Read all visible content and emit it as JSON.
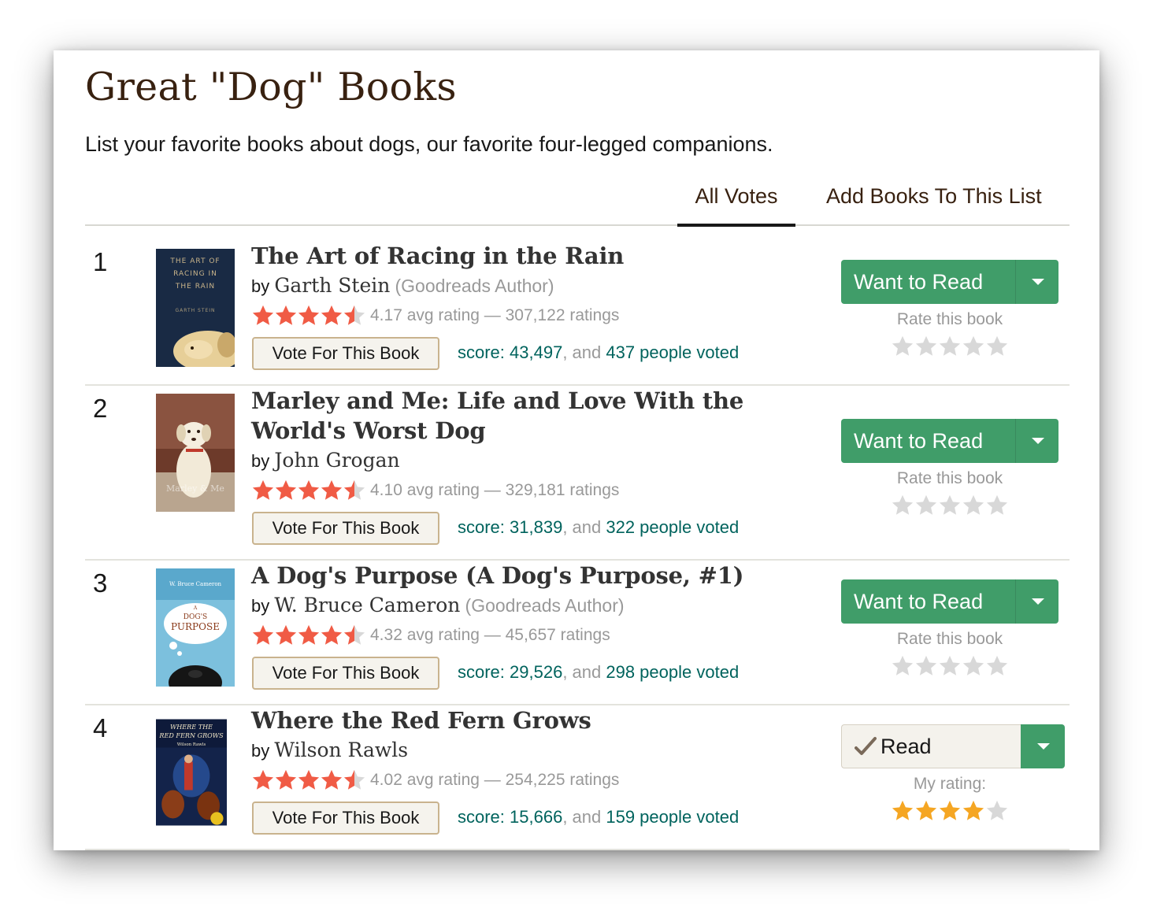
{
  "page": {
    "title": "Great \"Dog\" Books",
    "description": "List your favorite books about dogs, our favorite four-legged companions."
  },
  "tabs": [
    {
      "label": "All Votes",
      "active": true
    },
    {
      "label": "Add Books To This List",
      "active": false
    }
  ],
  "colors": {
    "title_brown": "#382110",
    "shelf_green": "#409d69",
    "link_teal": "#00635d",
    "star_red": "#f05b45",
    "star_gold": "#f5a623",
    "muted_gray": "#999999"
  },
  "books": [
    {
      "rank": "1",
      "title": "The Art of Racing in the Rain",
      "by": "by",
      "author": "Garth Stein",
      "author_badge": "(Goodreads Author)",
      "avg_rating_text": "4.17 avg rating — 307,122 ratings",
      "avg_rating": 4.17,
      "vote_label": "Vote For This Book",
      "score": "score: 43,497",
      "and": ", and ",
      "voted": "437 people voted",
      "shelf": {
        "state": "want",
        "button": "Want to Read",
        "rate_label": "Rate this book",
        "my_rating": 0
      }
    },
    {
      "rank": "2",
      "title": "Marley and Me: Life and Love With the World's Worst Dog",
      "by": "by",
      "author": "John Grogan",
      "author_badge": "",
      "avg_rating_text": "4.10 avg rating — 329,181 ratings",
      "avg_rating": 4.1,
      "vote_label": "Vote For This Book",
      "score": "score: 31,839",
      "and": ", and ",
      "voted": "322 people voted",
      "shelf": {
        "state": "want",
        "button": "Want to Read",
        "rate_label": "Rate this book",
        "my_rating": 0
      }
    },
    {
      "rank": "3",
      "title": "A Dog's Purpose (A Dog's Purpose, #1)",
      "by": "by",
      "author": "W. Bruce Cameron",
      "author_badge": "(Goodreads Author)",
      "avg_rating_text": "4.32 avg rating — 45,657 ratings",
      "avg_rating": 4.32,
      "vote_label": "Vote For This Book",
      "score": "score: 29,526",
      "and": ", and ",
      "voted": "298 people voted",
      "shelf": {
        "state": "want",
        "button": "Want to Read",
        "rate_label": "Rate this book",
        "my_rating": 0
      }
    },
    {
      "rank": "4",
      "title": "Where the Red Fern Grows",
      "by": "by",
      "author": "Wilson Rawls",
      "author_badge": "",
      "avg_rating_text": "4.02 avg rating — 254,225 ratings",
      "avg_rating": 4.02,
      "vote_label": "Vote For This Book",
      "score": "score: 15,666",
      "and": ", and ",
      "voted": "159 people voted",
      "shelf": {
        "state": "read",
        "button": "Read",
        "rate_label": "My rating:",
        "my_rating": 4
      }
    }
  ],
  "covers": [
    {
      "icon": "book-cover-art-of-racing",
      "text": [
        "THE ART OF",
        "RACING IN",
        "THE RAIN",
        "GARTH STEIN"
      ]
    },
    {
      "icon": "book-cover-marley-and-me",
      "text": [
        "Marley & Me"
      ]
    },
    {
      "icon": "book-cover-dogs-purpose",
      "text": [
        "W. Bruce Cameron",
        "A",
        "DOG'S",
        "PURPOSE"
      ]
    },
    {
      "icon": "book-cover-red-fern",
      "text": [
        "WHERE THE",
        "RED FERN GROWS",
        "Wilson Rawls"
      ]
    }
  ]
}
